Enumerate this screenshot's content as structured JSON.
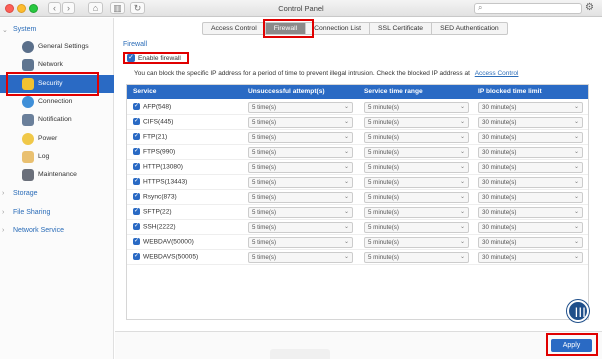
{
  "window": {
    "title": "Control Panel",
    "search_placeholder": ""
  },
  "sidebar": {
    "groups": [
      {
        "label": "System",
        "expanded": true
      },
      {
        "label": "Storage",
        "expanded": false
      },
      {
        "label": "File Sharing",
        "expanded": false
      },
      {
        "label": "Network Service",
        "expanded": false
      }
    ],
    "items": [
      {
        "label": "General Settings",
        "icon": "general-settings-icon"
      },
      {
        "label": "Network",
        "icon": "network-icon"
      },
      {
        "label": "Security",
        "icon": "security-icon",
        "active": true
      },
      {
        "label": "Connection",
        "icon": "connection-icon"
      },
      {
        "label": "Notification",
        "icon": "notification-icon"
      },
      {
        "label": "Power",
        "icon": "power-icon"
      },
      {
        "label": "Log",
        "icon": "log-icon"
      },
      {
        "label": "Maintenance",
        "icon": "maintenance-icon"
      }
    ]
  },
  "tabs": [
    {
      "label": "Access Control"
    },
    {
      "label": "Firewall",
      "active": true
    },
    {
      "label": "Connection List"
    },
    {
      "label": "SSL Certificate"
    },
    {
      "label": "SED Authentication"
    }
  ],
  "firewall": {
    "section_title": "Firewall",
    "enable_label": "Enable firewall",
    "enable_checked": true,
    "info_text": "You can block the specific IP address for a period of time to prevent illegal intrusion. Check the blocked IP address at",
    "info_link": "Access Control",
    "columns": [
      "Service",
      "Unsuccessful attempt(s)",
      "Service time range",
      "IP blocked time limit"
    ],
    "rows": [
      {
        "service": "AFP(548)",
        "attempts": "5 time(s)",
        "range": "5 minute(s)",
        "blocked": "30 minute(s)"
      },
      {
        "service": "CIFS(445)",
        "attempts": "5 time(s)",
        "range": "5 minute(s)",
        "blocked": "30 minute(s)"
      },
      {
        "service": "FTP(21)",
        "attempts": "5 time(s)",
        "range": "5 minute(s)",
        "blocked": "30 minute(s)"
      },
      {
        "service": "FTPS(990)",
        "attempts": "5 time(s)",
        "range": "5 minute(s)",
        "blocked": "30 minute(s)"
      },
      {
        "service": "HTTP(13080)",
        "attempts": "5 time(s)",
        "range": "5 minute(s)",
        "blocked": "30 minute(s)"
      },
      {
        "service": "HTTPS(13443)",
        "attempts": "5 time(s)",
        "range": "5 minute(s)",
        "blocked": "30 minute(s)"
      },
      {
        "service": "Rsync(873)",
        "attempts": "5 time(s)",
        "range": "5 minute(s)",
        "blocked": "30 minute(s)"
      },
      {
        "service": "SFTP(22)",
        "attempts": "5 time(s)",
        "range": "5 minute(s)",
        "blocked": "30 minute(s)"
      },
      {
        "service": "SSH(2222)",
        "attempts": "5 time(s)",
        "range": "5 minute(s)",
        "blocked": "30 minute(s)"
      },
      {
        "service": "WEBDAV(50000)",
        "attempts": "5 time(s)",
        "range": "5 minute(s)",
        "blocked": "30 minute(s)"
      },
      {
        "service": "WEBDAVS(50005)",
        "attempts": "5 time(s)",
        "range": "5 minute(s)",
        "blocked": "30 minute(s)"
      }
    ]
  },
  "footer": {
    "apply_label": "Apply"
  }
}
